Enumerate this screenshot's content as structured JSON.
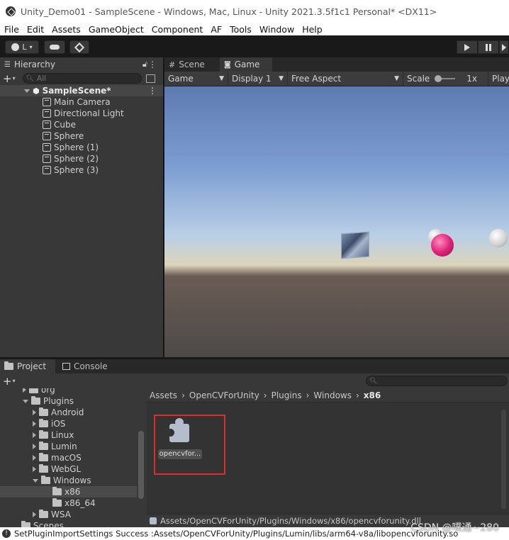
{
  "window": {
    "title": "Unity_Demo01 - SampleScene - Windows, Mac, Linux - Unity 2021.3.5f1c1 Personal* <DX11>"
  },
  "menu": [
    "File",
    "Edit",
    "Assets",
    "GameObject",
    "Component",
    "AF",
    "Tools",
    "Window",
    "Help"
  ],
  "toolbar": {
    "account_label": "L"
  },
  "hierarchy": {
    "tab_label": "Hierarchy",
    "search_placeholder": "All",
    "scene_name": "SampleScene*",
    "items": [
      "Main Camera",
      "Directional Light",
      "Cube",
      "Sphere",
      "Sphere (1)",
      "Sphere (2)",
      "Sphere (3)"
    ]
  },
  "game": {
    "tabs": [
      "Scene",
      "Game"
    ],
    "mode": "Game",
    "display": "Display 1",
    "aspect": "Free Aspect",
    "scale_label": "Scale",
    "scale_value": "1x",
    "play_label": "Play"
  },
  "project": {
    "tabs": [
      "Project",
      "Console"
    ],
    "tree": [
      {
        "label": "org",
        "depth": 0,
        "expanded": false
      },
      {
        "label": "Plugins",
        "depth": 0,
        "expanded": true
      },
      {
        "label": "Android",
        "depth": 1,
        "expanded": false
      },
      {
        "label": "iOS",
        "depth": 1,
        "expanded": false
      },
      {
        "label": "Linux",
        "depth": 1,
        "expanded": false
      },
      {
        "label": "Lumin",
        "depth": 1,
        "expanded": false
      },
      {
        "label": "macOS",
        "depth": 1,
        "expanded": false
      },
      {
        "label": "WebGL",
        "depth": 1,
        "expanded": false
      },
      {
        "label": "Windows",
        "depth": 1,
        "expanded": true
      },
      {
        "label": "x86",
        "depth": 2,
        "selected": true
      },
      {
        "label": "x86_64",
        "depth": 2
      },
      {
        "label": "WSA",
        "depth": 1,
        "expanded": false
      },
      {
        "label": "Scenes",
        "depth": -1
      }
    ],
    "breadcrumb": [
      "Assets",
      "OpenCVForUnity",
      "Plugins",
      "Windows",
      "x86"
    ],
    "asset": {
      "label": "opencvfor...",
      "icon": "plugin-puzzle-icon"
    },
    "selected_path": "Assets/OpenCVForUnity/Plugins/Windows/x86/opencvforunity.dll"
  },
  "status": {
    "message": "SetPluginImportSettings Success :Assets/OpenCVForUnity/Plugins/Lumin/libs/arm64-v8a/libopencvforunity.so"
  },
  "watermark": "CSDN @噗通~280",
  "colors": {
    "highlight_box": "#e02c2c",
    "pink_sphere": "#e0267a"
  }
}
